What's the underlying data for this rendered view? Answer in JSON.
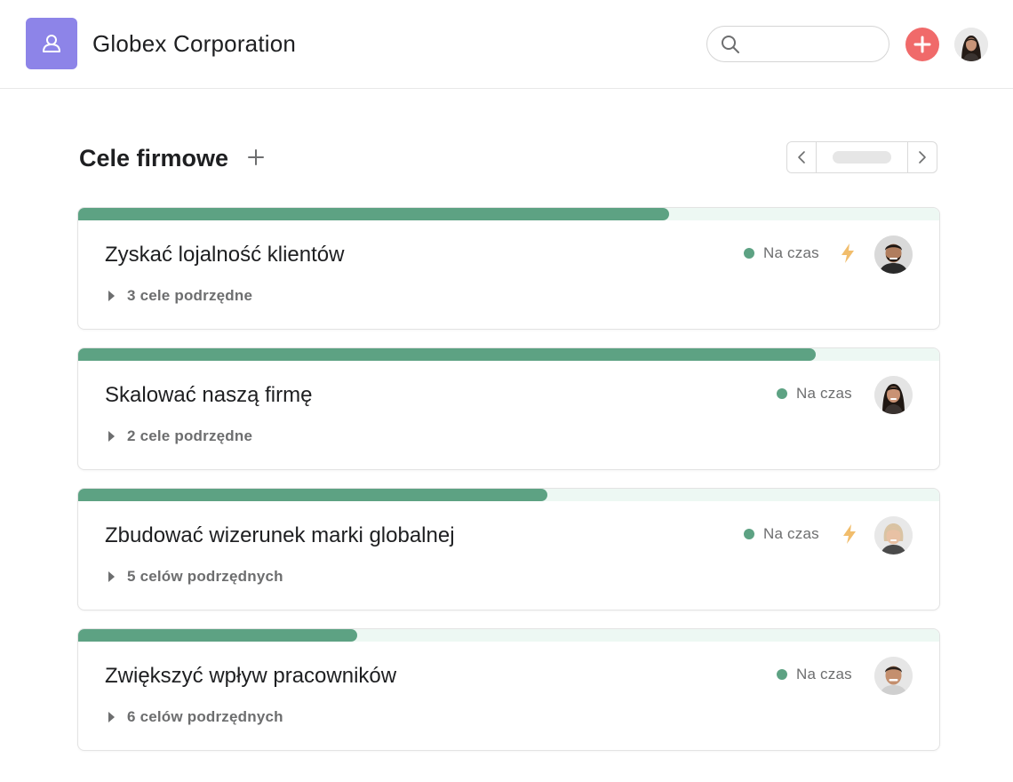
{
  "header": {
    "org_name": "Globex Corporation",
    "logo_icon": "people-icon",
    "search_placeholder": "",
    "add_icon": "plus-icon",
    "accent_color": "#f06a6a",
    "logo_color": "#8d84e8"
  },
  "section": {
    "title": "Cele firmowe",
    "add_icon": "plus-icon"
  },
  "status_color": "#5da283",
  "goals": [
    {
      "title": "Zyskać lojalność klientów",
      "subgoals": "3 cele podrzędne",
      "status": "Na czas",
      "progress": 0.686,
      "bolt": true,
      "owner": "man-dark-hair-beard"
    },
    {
      "title": "Skalować naszą firmę",
      "subgoals": "2 cele podrzędne",
      "status": "Na czas",
      "progress": 0.857,
      "bolt": false,
      "owner": "woman-dark-hair"
    },
    {
      "title": "Zbudować wizerunek marki globalnej",
      "subgoals": "5 celów podrzędnych",
      "status": "Na czas",
      "progress": 0.545,
      "bolt": true,
      "owner": "woman-blonde-hair"
    },
    {
      "title": "Zwiększyć wpływ pracowników",
      "subgoals": "6 celów podrzędnych",
      "status": "Na czas",
      "progress": 0.324,
      "bolt": false,
      "owner": "man-short-hair"
    }
  ]
}
